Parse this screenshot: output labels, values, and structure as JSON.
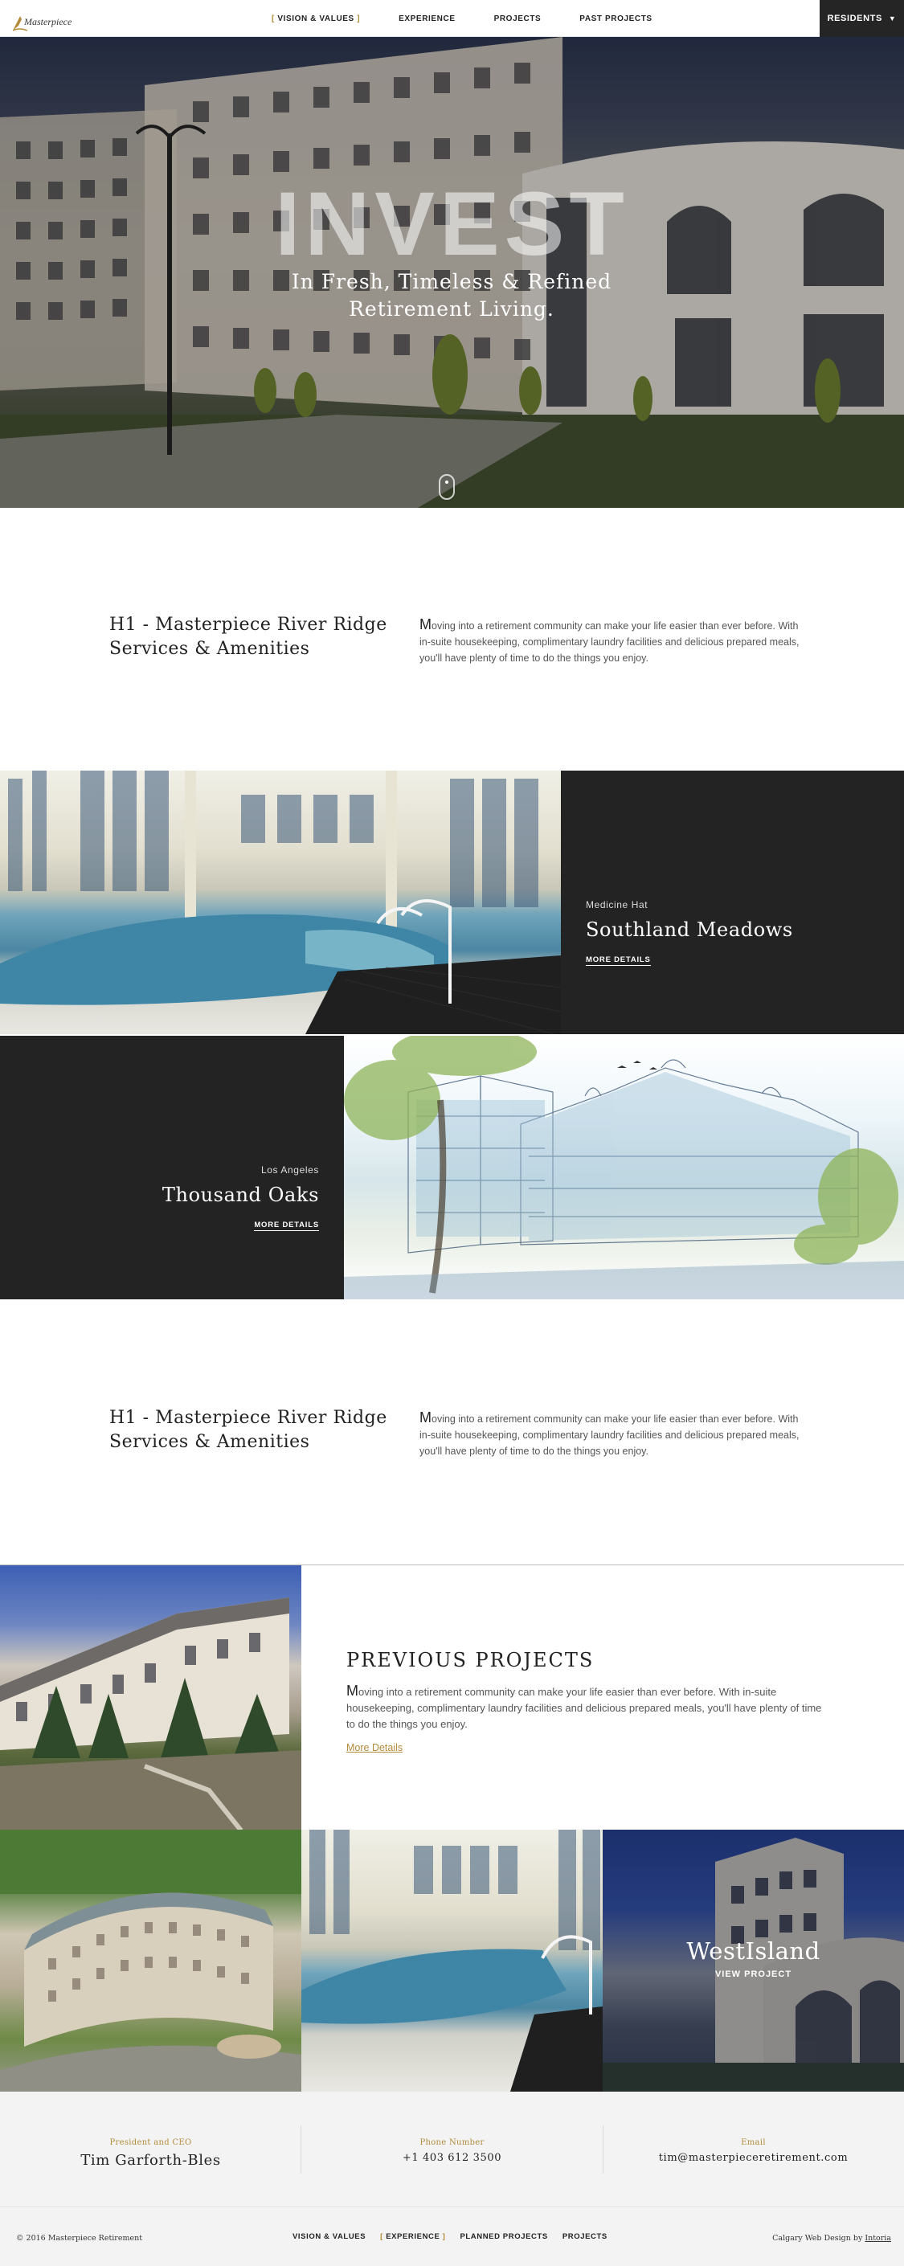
{
  "nav": {
    "logo_text": "Masterpiece",
    "links": [
      {
        "label": "VISION & VALUES",
        "active": true
      },
      {
        "label": "EXPERIENCE",
        "active": false
      },
      {
        "label": "PROJECTS",
        "active": false
      },
      {
        "label": "PAST PROJECTS",
        "active": false
      }
    ],
    "residents_label": "RESIDENTS",
    "residents_icon": "chevron-down-icon"
  },
  "hero": {
    "title": "INVEST",
    "subtitle": "In Fresh, Timeless & Refined Retirement Living.",
    "scroll_icon": "mouse-scroll-icon"
  },
  "intro1": {
    "heading": "H1 - Masterpiece River Ridge Services & Amenities",
    "drop": "M",
    "body": "oving into a retirement community can make your life easier than ever before. With in-suite housekeeping, complimentary laundry facilities and delicious prepared meals, you'll have plenty of time to do the things you enjoy."
  },
  "projects": [
    {
      "location": "Medicine Hat",
      "name": "Southland Meadows",
      "link": "MORE DETAILS"
    },
    {
      "location": "Los Angeles",
      "name": "Thousand Oaks",
      "link": "MORE DETAILS"
    }
  ],
  "intro2": {
    "heading": "H1 - Masterpiece River Ridge Services & Amenities",
    "drop": "M",
    "body": "oving into a retirement community can make your life easier than ever before. With in-suite housekeeping, complimentary laundry facilities and delicious prepared meals, you'll have plenty of time to do the things you enjoy."
  },
  "previous": {
    "heading": "PREVIOUS PROJECTS",
    "drop": "M",
    "body": "oving into a retirement community can make your life easier than ever before. With in-suite housekeeping, complimentary laundry facilities and delicious prepared meals, you'll have plenty of time to do the things you enjoy.",
    "link": "More Details"
  },
  "tiles": {
    "featured_title": "WestIsland",
    "featured_link": "VIEW PROJECT"
  },
  "contact": [
    {
      "label": "President and CEO",
      "value": "Tim Garforth-Bles"
    },
    {
      "label": "Phone Number",
      "value": "+1 403 612 3500"
    },
    {
      "label": "Email",
      "value": "tim@masterpieceretirement.com"
    }
  ],
  "footer": {
    "copyright": "© 2016 Masterpiece Retirement",
    "links": [
      {
        "label": "VISION & VALUES",
        "active": false
      },
      {
        "label": "EXPERIENCE",
        "active": true
      },
      {
        "label": "PLANNED PROJECTS",
        "active": false
      },
      {
        "label": "PROJECTS",
        "active": false
      }
    ],
    "credit_prefix": "Calgary Web Design by ",
    "credit_link": "Intoria"
  },
  "colors": {
    "accent": "#b28c3b",
    "dark_panel": "#232323",
    "footer_bg": "#f3f3f3"
  }
}
